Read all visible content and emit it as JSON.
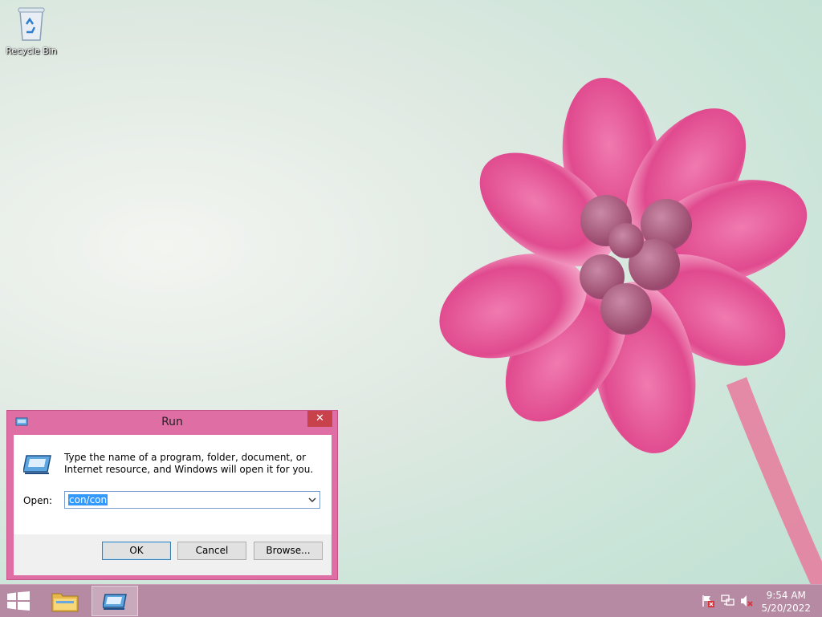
{
  "desktop": {
    "icons": [
      {
        "label": "Recycle Bin",
        "icon": "recycle-bin-icon"
      }
    ]
  },
  "run_dialog": {
    "title": "Run",
    "close_label": "✕",
    "description": "Type the name of a program, folder, document, or Internet resource, and Windows will open it for you.",
    "open_label": "Open:",
    "open_value": "con/con",
    "buttons": {
      "ok": "OK",
      "cancel": "Cancel",
      "browse": "Browse..."
    }
  },
  "taskbar": {
    "items": [
      "start-icon",
      "file-explorer-icon",
      "run-icon"
    ],
    "tray": [
      "action-center-flag-icon",
      "network-icon",
      "volume-muted-icon"
    ],
    "clock": {
      "time": "9:54 AM",
      "date": "5/20/2022"
    }
  },
  "colors": {
    "window_accent": "#de6ea4",
    "taskbar": "#b58aa2",
    "close_button": "#c7424a",
    "selection": "#3399ff"
  }
}
